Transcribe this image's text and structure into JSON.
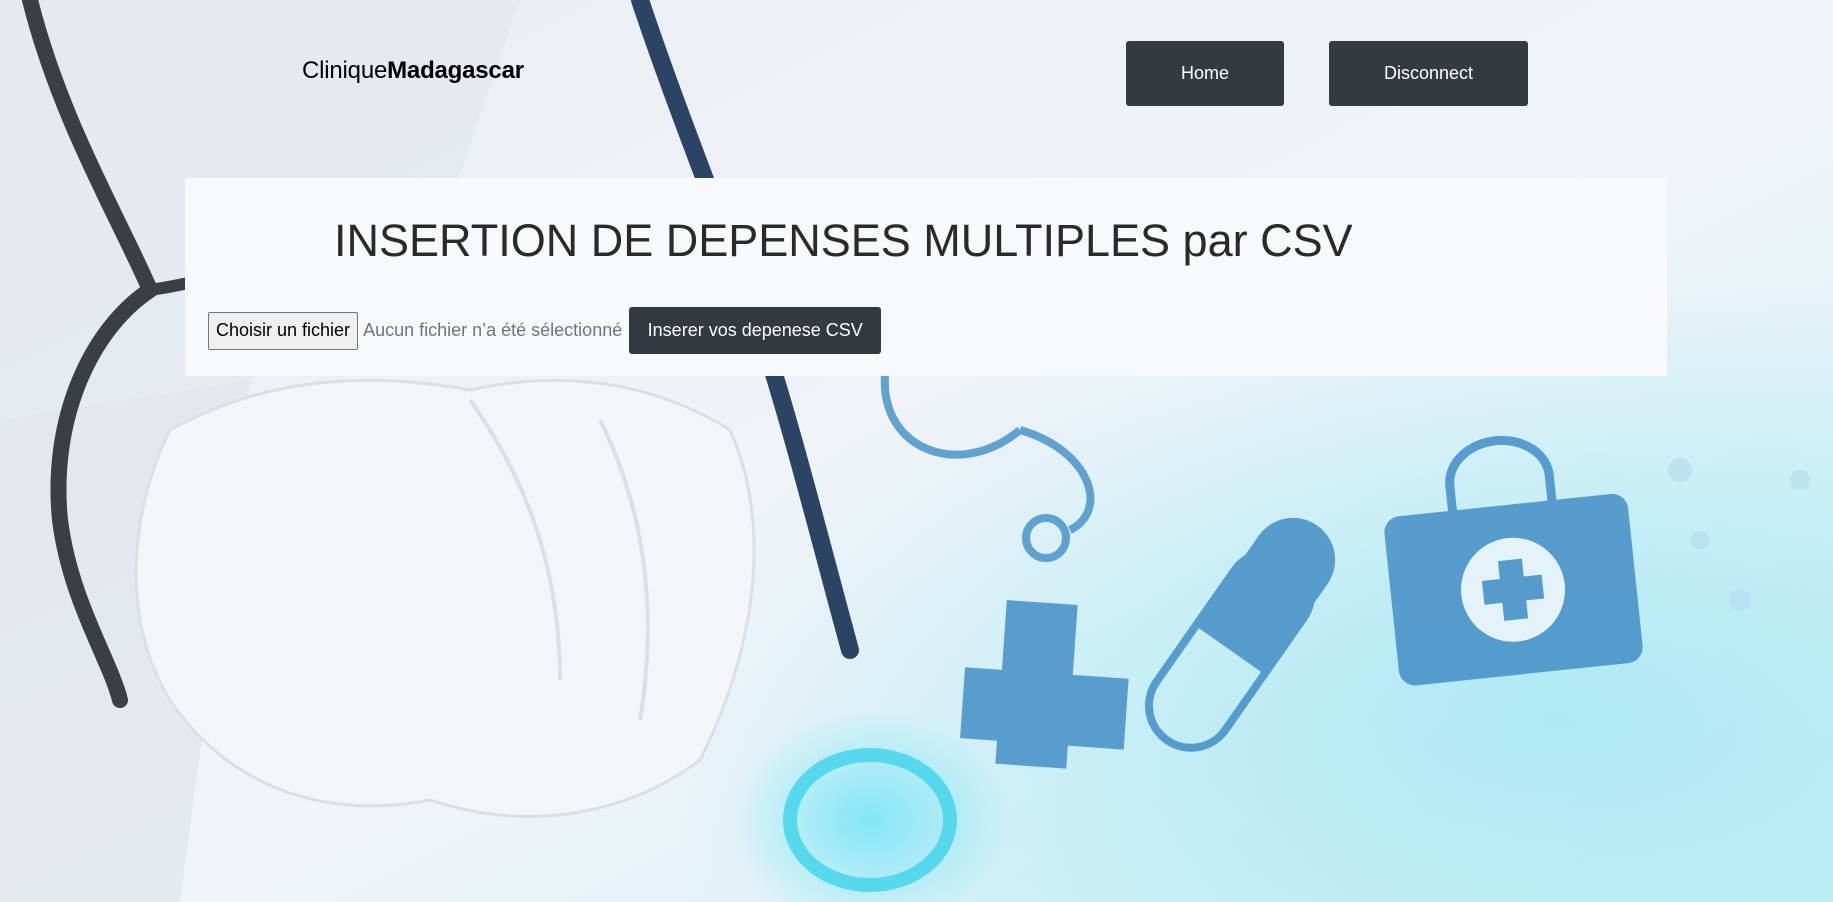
{
  "brand": {
    "prefix": "Clinique",
    "bold": "Madagascar"
  },
  "nav": {
    "home_label": "Home",
    "disconnect_label": "Disconnect"
  },
  "panel": {
    "title": "INSERTION DE DEPENSES MULTIPLES par CSV",
    "file_button_label": "Choisir un fichier",
    "file_status": "Aucun fichier n’a été sélectionné",
    "submit_label": "Inserer vos depenese CSV"
  },
  "colors": {
    "button_dark": "#343a40",
    "panel_bg": "#f8f9fa",
    "icon_blue": "#4a94c9"
  }
}
